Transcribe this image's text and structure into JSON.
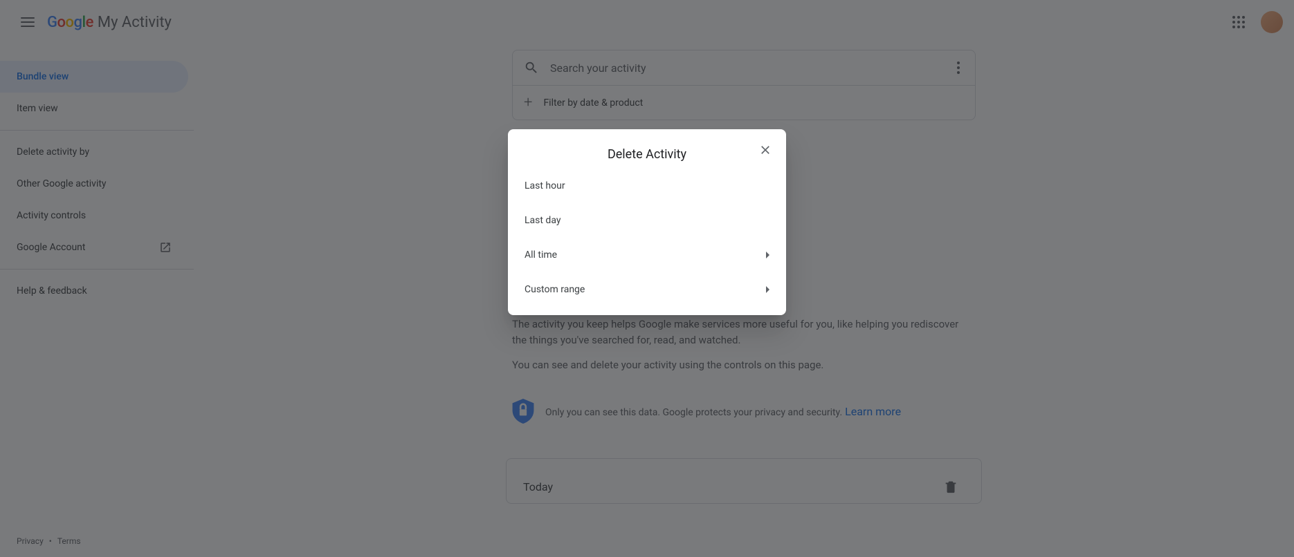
{
  "header": {
    "app_title": "My Activity"
  },
  "sidebar": {
    "items": [
      "Bundle view",
      "Item view",
      "Delete activity by",
      "Other Google activity",
      "Activity controls",
      "Google Account",
      "Help & feedback"
    ]
  },
  "footer": {
    "privacy": "Privacy",
    "terms": "Terms"
  },
  "search": {
    "placeholder": "Search your activity",
    "filter_label": "Filter by date & product"
  },
  "main": {
    "desc1": "The activity you keep helps Google make services more useful for you, like helping you rediscover the things you've searched for, read, and watched.",
    "desc2": "You can see and delete your activity using the controls on this page.",
    "privacy_text": "Only you can see this data. Google protects your privacy and security.",
    "learn_more": "Learn more",
    "today": "Today"
  },
  "dialog": {
    "title": "Delete Activity",
    "opts": [
      "Last hour",
      "Last day",
      "All time",
      "Custom range"
    ]
  }
}
